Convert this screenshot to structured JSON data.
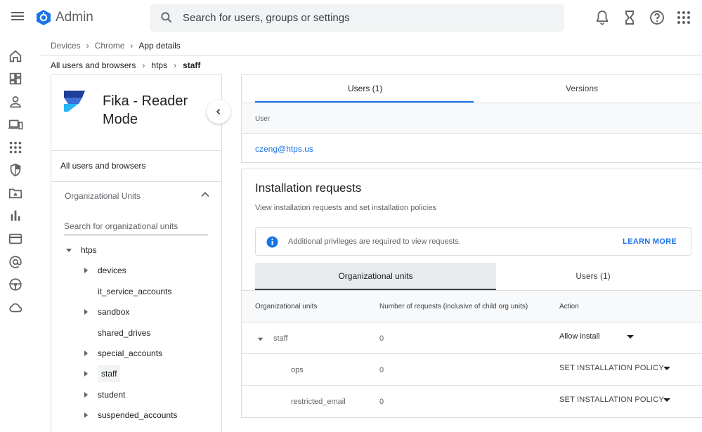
{
  "header": {
    "brand": "Admin",
    "search_placeholder": "Search for users, groups or settings"
  },
  "breadcrumb": [
    "Devices",
    "Chrome",
    "App details"
  ],
  "ou_breadcrumb": [
    "All users and browsers",
    "htps",
    "staff"
  ],
  "app": {
    "name": "Fika - Reader Mode"
  },
  "left_panel": {
    "all_users": "All users and browsers",
    "ou_title": "Organizational Units",
    "ou_search_placeholder": "Search for organizational units",
    "tree": [
      {
        "label": "htps",
        "expanded": true
      },
      {
        "label": "devices",
        "has_children": true
      },
      {
        "label": "it_service_accounts",
        "has_children": false
      },
      {
        "label": "sandbox",
        "has_children": true
      },
      {
        "label": "shared_drives",
        "has_children": false
      },
      {
        "label": "special_accounts",
        "has_children": true
      },
      {
        "label": "staff",
        "has_children": true,
        "selected": true
      },
      {
        "label": "student",
        "has_children": true
      },
      {
        "label": "suspended_accounts",
        "has_children": true
      }
    ]
  },
  "top_tabs": [
    "Users (1)",
    "Versions"
  ],
  "users_table": {
    "column": "User",
    "rows": [
      "czeng@htps.us"
    ]
  },
  "installation": {
    "title": "Installation requests",
    "subtitle": "View installation requests and set installation policies",
    "notice": "Additional privileges are required to view requests.",
    "learn_more": "LEARN MORE",
    "tabs": [
      "Organizational units",
      "Users (1)"
    ],
    "columns": [
      "Organizational units",
      "Number of requests (inclusive of child org units)",
      "Action"
    ],
    "rows": [
      {
        "ou": "staff",
        "count": "0",
        "action": "Allow install"
      },
      {
        "ou": "ops",
        "count": "0",
        "action": "SET INSTALLATION POLICY"
      },
      {
        "ou": "restricted_email",
        "count": "0",
        "action": "SET INSTALLATION POLICY"
      }
    ]
  },
  "colors": {
    "accent": "#1a73e8",
    "icon_gray": "#5f6368",
    "logo_dark": "#1f3f96",
    "logo_light": "#29b6f6"
  },
  "icons": {
    "rail": [
      "home-icon",
      "dashboard-icon",
      "person-icon",
      "devices-icon",
      "apps-icon",
      "security-icon",
      "folder-star-icon",
      "reports-icon",
      "billing-icon",
      "at-icon",
      "rules-icon",
      "cloud-icon"
    ],
    "top": [
      "bell-icon",
      "hourglass-icon",
      "help-icon",
      "apps-grid-icon"
    ]
  }
}
